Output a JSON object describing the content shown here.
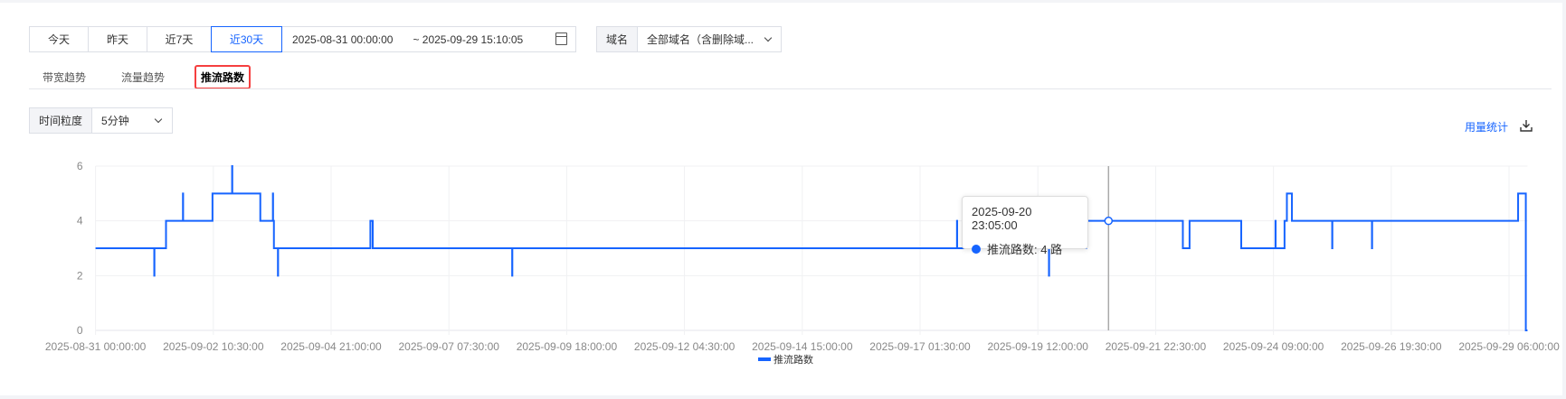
{
  "filters": {
    "ranges": [
      "今天",
      "昨天",
      "近7天",
      "近30天"
    ],
    "active_range": "近30天",
    "date_start": "2025-08-31 00:00:00",
    "date_end": "~ 2025-09-29 15:10:05",
    "domain_label": "域名",
    "domain_value": "全部域名（含删除域..."
  },
  "tabs": [
    "带宽趋势",
    "流量趋势",
    "推流路数"
  ],
  "active_tab": "推流路数",
  "granularity": {
    "label": "时间粒度",
    "value": "5分钟"
  },
  "usage_link": "用量统计",
  "tooltip": {
    "time": "2025-09-20 23:05:00",
    "series": "推流路数",
    "value_text": "推流路数: 4 路"
  },
  "colors": {
    "accent": "#1664ff",
    "highlight_box": "#f53f3f"
  },
  "chart_data": {
    "type": "line",
    "step": true,
    "title": "",
    "xlabel": "",
    "ylabel": "",
    "ylim": [
      0,
      6
    ],
    "yticks": [
      "0",
      "2",
      "4",
      "6"
    ],
    "xlim": [
      "2025-08-31 00:00",
      "2025-09-29 15:10"
    ],
    "xticks": [
      "2025-08-31 00:00:00",
      "2025-09-02 10:30:00",
      "2025-09-04 21:00:00",
      "2025-09-07 07:30:00",
      "2025-09-09 18:00:00",
      "2025-09-12 04:30:00",
      "2025-09-14 15:00:00",
      "2025-09-17 01:30:00",
      "2025-09-19 12:00:00",
      "2025-09-21 22:30:00",
      "2025-09-24 09:00:00",
      "2025-09-26 19:30:00",
      "2025-09-29 06:00:00"
    ],
    "grid": true,
    "legend": "bottom",
    "hover_time": "2025-09-20 23:05",
    "series": [
      {
        "name": "推流路数",
        "color": "#1664ff",
        "points": [
          [
            "2025-08-31 00:00",
            3
          ],
          [
            "2025-09-01 05:10",
            2
          ],
          [
            "2025-09-01 05:15",
            3
          ],
          [
            "2025-09-01 11:00",
            4
          ],
          [
            "2025-09-01 19:25",
            5
          ],
          [
            "2025-09-01 19:30",
            4
          ],
          [
            "2025-09-02 10:05",
            5
          ],
          [
            "2025-09-02 19:50",
            6
          ],
          [
            "2025-09-02 19:55",
            5
          ],
          [
            "2025-09-03 09:50",
            4
          ],
          [
            "2025-09-03 16:05",
            5
          ],
          [
            "2025-09-03 16:10",
            4
          ],
          [
            "2025-09-03 16:35",
            3
          ],
          [
            "2025-09-03 18:35",
            2
          ],
          [
            "2025-09-03 18:40",
            3
          ],
          [
            "2025-09-05 16:30",
            4
          ],
          [
            "2025-09-05 17:40",
            3
          ],
          [
            "2025-09-08 14:55",
            2
          ],
          [
            "2025-09-08 15:00",
            3
          ],
          [
            "2025-09-17 19:50",
            4
          ],
          [
            "2025-09-17 19:55",
            3
          ],
          [
            "2025-09-18 14:50",
            4
          ],
          [
            "2025-09-18 14:55",
            3
          ],
          [
            "2025-09-19 17:30",
            2
          ],
          [
            "2025-09-19 17:35",
            3
          ],
          [
            "2025-09-20 12:00",
            4
          ],
          [
            "2025-09-22 12:00",
            3
          ],
          [
            "2025-09-22 15:20",
            4
          ],
          [
            "2025-09-23 17:00",
            3
          ],
          [
            "2025-09-24 10:00",
            4
          ],
          [
            "2025-09-24 10:05",
            3
          ],
          [
            "2025-09-24 14:30",
            4
          ],
          [
            "2025-09-24 15:40",
            5
          ],
          [
            "2025-09-24 18:10",
            4
          ],
          [
            "2025-09-25 14:10",
            3
          ],
          [
            "2025-09-25 14:15",
            4
          ],
          [
            "2025-09-26 09:55",
            3
          ],
          [
            "2025-09-26 10:00",
            4
          ],
          [
            "2025-09-29 10:30",
            5
          ],
          [
            "2025-09-29 14:20",
            0
          ],
          [
            "2025-09-29 15:10",
            0
          ]
        ]
      }
    ]
  }
}
